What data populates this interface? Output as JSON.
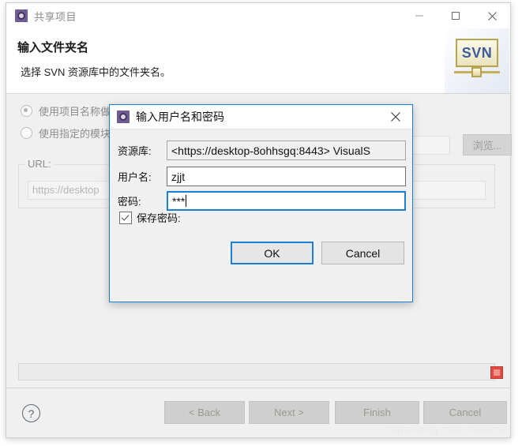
{
  "window": {
    "title": "共享项目",
    "icon": "svn-share-icon",
    "controls": {
      "minimize": "—",
      "maximize": "☐",
      "close": "✕"
    }
  },
  "header": {
    "title": "输入文件夹名",
    "description": "选择 SVN 资源库中的文件夹名。",
    "logo_text": "SVN"
  },
  "body": {
    "radio_options": [
      {
        "label": "使用项目名称做",
        "selected": true
      },
      {
        "label": "使用指定的模块",
        "selected": false
      }
    ],
    "url_group_label": "URL:",
    "url_value": "https://desktop",
    "browse_label": "浏览...",
    "stop_indicator": "stop-icon"
  },
  "footer": {
    "help": "?",
    "buttons": [
      {
        "label": "< Back",
        "enabled": false
      },
      {
        "label": "Next >",
        "enabled": false
      },
      {
        "label": "Finish",
        "enabled": false
      },
      {
        "label": "Cancel",
        "enabled": false
      }
    ]
  },
  "watermark": "https://blog.csdn.net/licmi",
  "dialog": {
    "title": "输入用户名和密码",
    "icon": "svn-auth-icon",
    "close": "✕",
    "fields": {
      "repository_label": "资源库:",
      "repository_value": "<https://desktop-8ohhsgq:8443> VisualS",
      "username_label": "用户名:",
      "username_value": "zjjt",
      "password_label": "密码:",
      "password_value": "***"
    },
    "save_password_label": "保存密码:",
    "save_password_checked": true,
    "ok_label": "OK",
    "cancel_label": "Cancel"
  }
}
